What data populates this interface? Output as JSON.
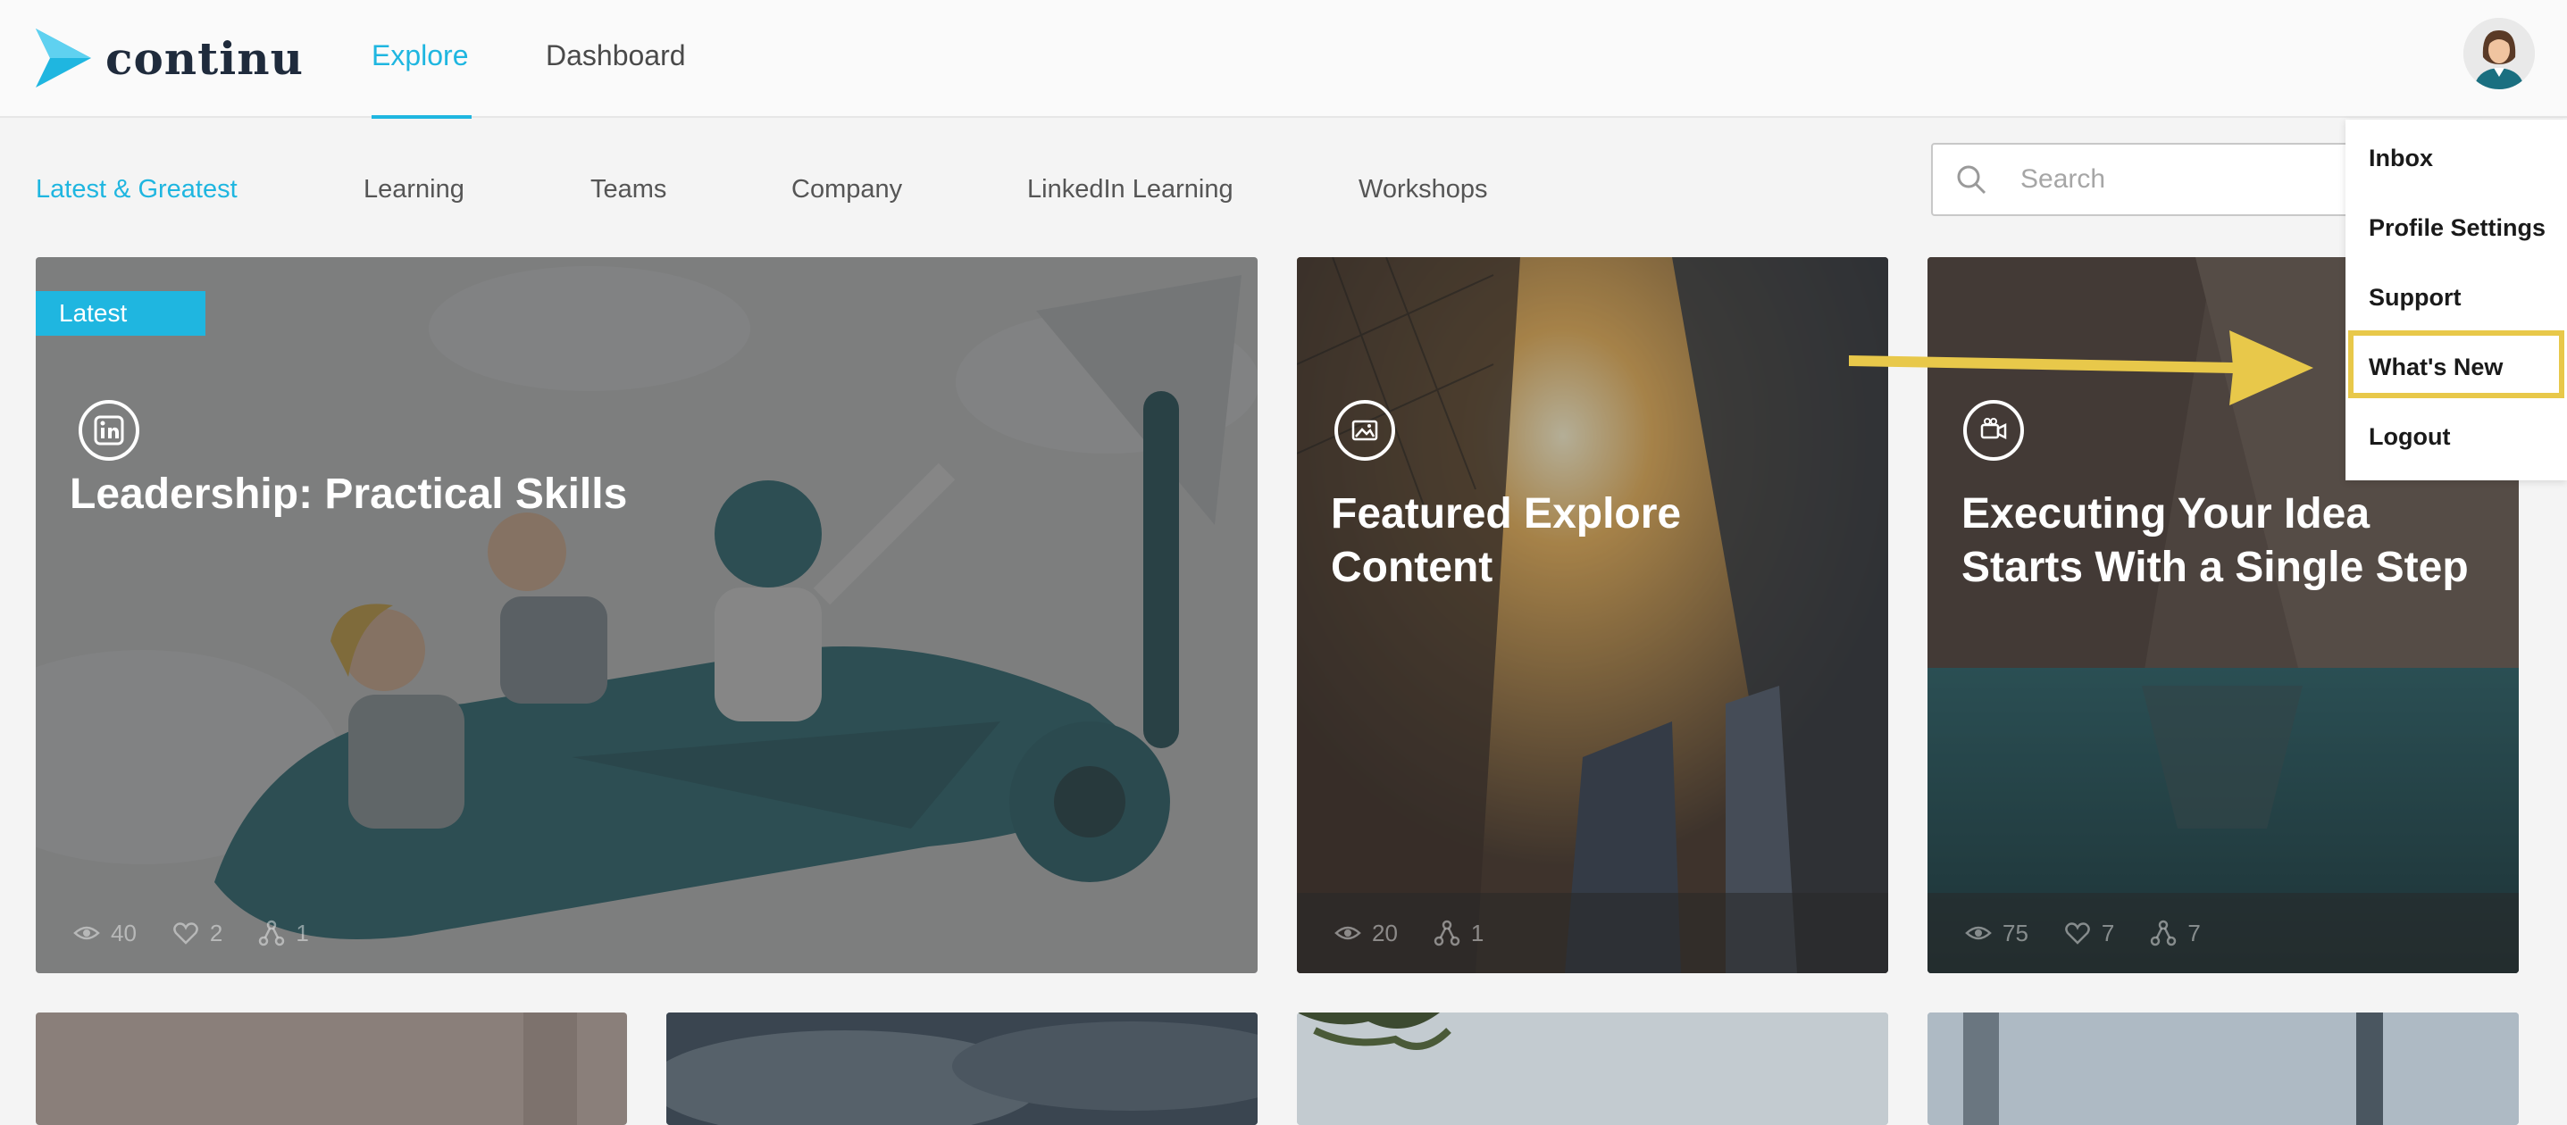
{
  "app": {
    "name": "continu"
  },
  "header": {
    "tabs": [
      {
        "label": "Explore",
        "active": true
      },
      {
        "label": "Dashboard",
        "active": false
      }
    ]
  },
  "categories": [
    {
      "label": "Latest & Greatest",
      "active": true
    },
    {
      "label": "Learning"
    },
    {
      "label": "Teams"
    },
    {
      "label": "Company"
    },
    {
      "label": "LinkedIn Learning"
    },
    {
      "label": "Workshops"
    }
  ],
  "search": {
    "placeholder": "Search"
  },
  "cards": [
    {
      "badge": "Latest",
      "title": "Leadership: Practical Skills",
      "icon": "linkedin-icon",
      "stats": {
        "views": "40",
        "likes": "2",
        "shares": "1"
      }
    },
    {
      "title_line1": "Featured Explore",
      "title_line2": "Content",
      "icon": "image-icon",
      "stats": {
        "views": "20",
        "shares": "1"
      }
    },
    {
      "title_line1": "Executing Your Idea",
      "title_line2": "Starts With a Single Step",
      "icon": "video-icon",
      "stats": {
        "views": "75",
        "likes": "7",
        "shares": "7"
      }
    }
  ],
  "user_menu": {
    "items": [
      "Inbox",
      "Profile Settings",
      "Support",
      "What's New",
      "Logout"
    ],
    "highlighted": "What's New"
  },
  "colors": {
    "accent": "#1fb6e0",
    "highlight": "#e8c84a",
    "logo_dark": "#1f2b3c"
  }
}
